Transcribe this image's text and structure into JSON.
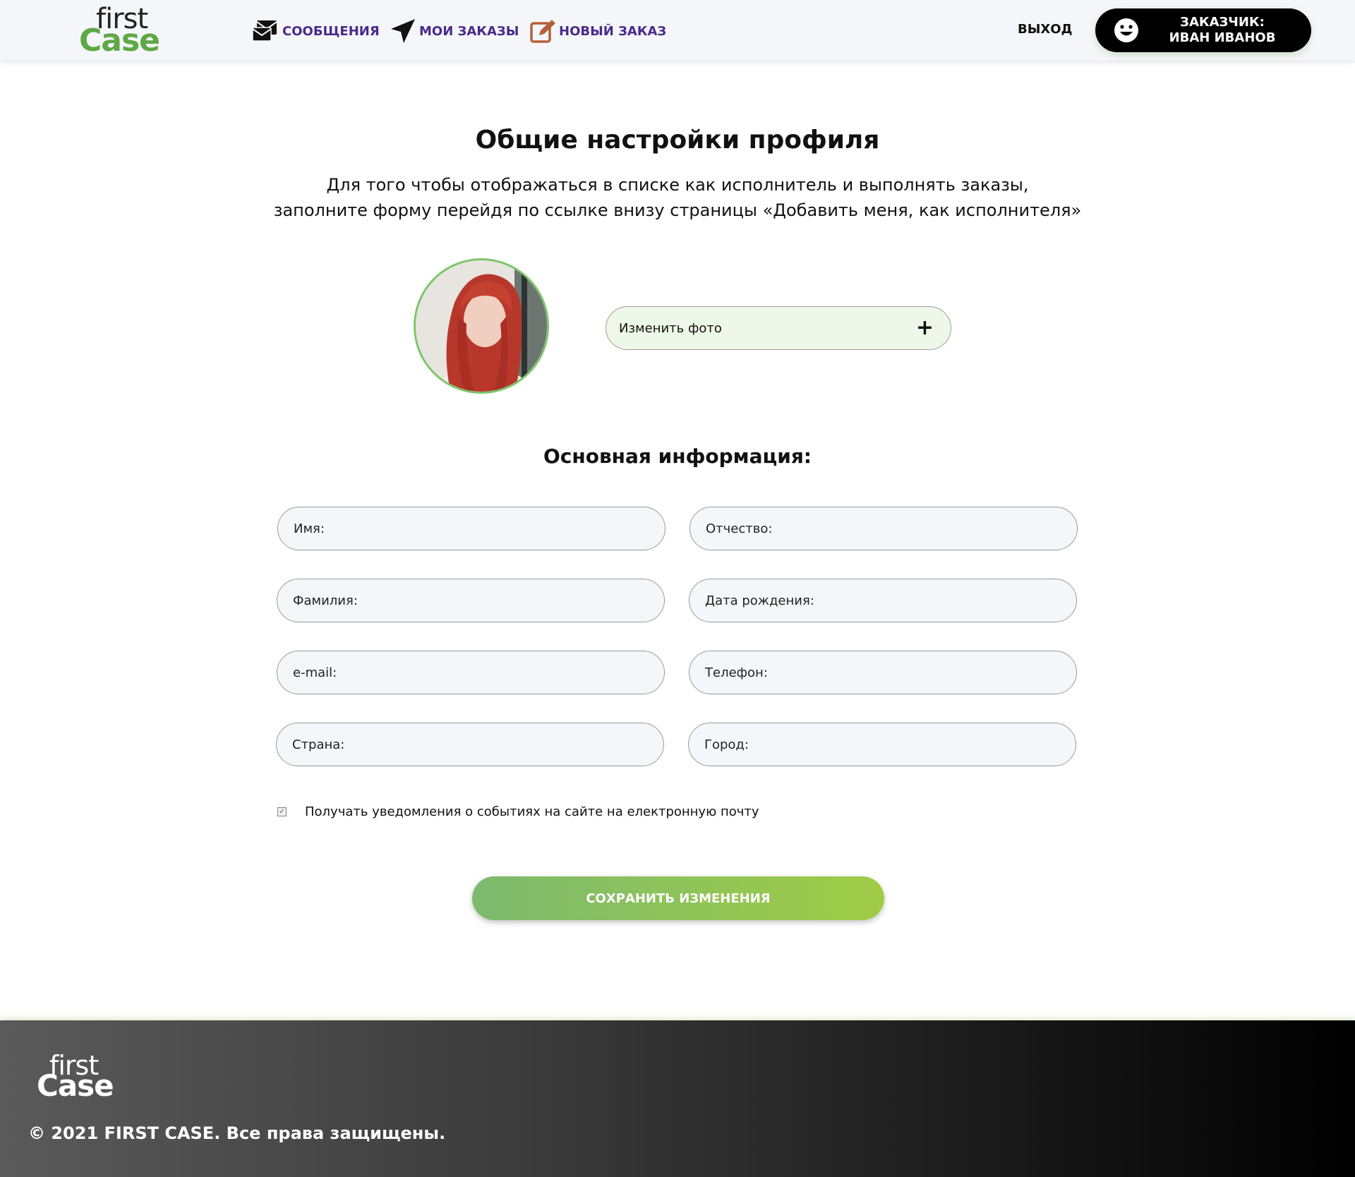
{
  "header": {
    "logo_first": "first",
    "logo_case": "Case",
    "nav": [
      {
        "label": "Сообщения",
        "icon": "envelopes-icon"
      },
      {
        "label": "Мои заказы",
        "icon": "paper-plane-icon"
      },
      {
        "label": "Новый заказ",
        "icon": "edit-icon"
      }
    ],
    "exit_label": "ВЫХОД",
    "user_role": "ЗАКАЗЧИК:",
    "user_name": "ИВАН ИВАНОВ"
  },
  "main": {
    "title": "Общие настройки профиля",
    "intro_line1": "Для того чтобы отображаться в списке как исполнитель и выполнять заказы,",
    "intro_line2": "заполните форму перейдя по ссылке внизу страницы «Добавить меня, как исполнителя»",
    "change_photo_label": "Изменить фото",
    "change_photo_plus": "+",
    "section_title": "Основная информация:",
    "fields": [
      {
        "label": "Имя:",
        "value": ""
      },
      {
        "label": "Отчество:",
        "value": ""
      },
      {
        "label": "Фамилия:",
        "value": ""
      },
      {
        "label": "Дата рождения:",
        "value": ""
      },
      {
        "label": "e-mail:",
        "value": ""
      },
      {
        "label": "Телефон:",
        "value": ""
      },
      {
        "label": "Страна:",
        "value": ""
      },
      {
        "label": "Город:",
        "value": ""
      }
    ],
    "notify_checked": true,
    "notify_label": "Получать уведомления о событиях на сайте на електронную почту",
    "save_label": "СОХРАНИТЬ ИЗМЕНЕНИЯ"
  },
  "footer": {
    "logo_first": "first",
    "logo_case": "Case",
    "copyright": "© 2021 FIRST CASE. Все права защищены."
  },
  "colors": {
    "brand_green": "#5ea845",
    "nav_purple": "#4a2a8a",
    "edit_icon_orange": "#b5613a"
  }
}
